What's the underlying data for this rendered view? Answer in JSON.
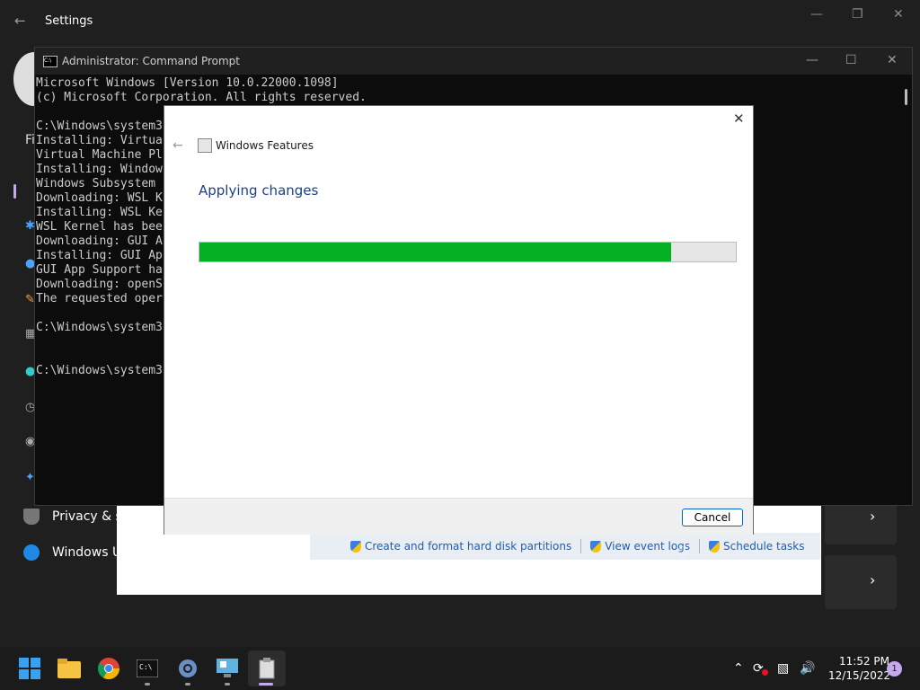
{
  "settings": {
    "title": "Settings",
    "sidebar_partial": [
      "Fi"
    ],
    "privacy_label": "Privacy & s",
    "update_label": "Windows U",
    "colors": {
      "bg": "#1f1f1f"
    }
  },
  "control_panel": {
    "links": [
      {
        "label": "Create and format hard disk partitions",
        "icon": "shield-icon"
      },
      {
        "label": "View event logs",
        "icon": "shield-icon"
      },
      {
        "label": "Schedule tasks",
        "icon": "shield-icon"
      }
    ]
  },
  "cmd": {
    "title": "Administrator: Command Prompt",
    "lines": [
      "Microsoft Windows [Version 10.0.22000.1098]",
      "(c) Microsoft Corporation. All rights reserved.",
      "",
      "C:\\Windows\\system3",
      "Installing: Virtua",
      "Virtual Machine Pl",
      "Installing: Window",
      "Windows Subsystem ",
      "Downloading: WSL K",
      "Installing: WSL Ke",
      "WSL Kernel has bee",
      "Downloading: GUI A",
      "Installing: GUI Ap",
      "GUI App Support ha",
      "Downloading: openS",
      "The requested oper",
      "",
      "C:\\Windows\\system3",
      "",
      "",
      "C:\\Windows\\system3"
    ]
  },
  "dialog": {
    "title": "Windows Features",
    "heading": "Applying changes",
    "progress": 0.88,
    "cancel_label": "Cancel",
    "colors": {
      "progress": "#06b025",
      "heading": "#1e3f86"
    }
  },
  "taskbar": {
    "apps": [
      "start-icon",
      "file-explorer-icon",
      "chrome-icon",
      "terminal-icon",
      "settings-icon",
      "control-panel-icon",
      "windows-features-icon"
    ],
    "time": "11:52 PM",
    "date": "12/15/2022",
    "notification_count": "1"
  }
}
